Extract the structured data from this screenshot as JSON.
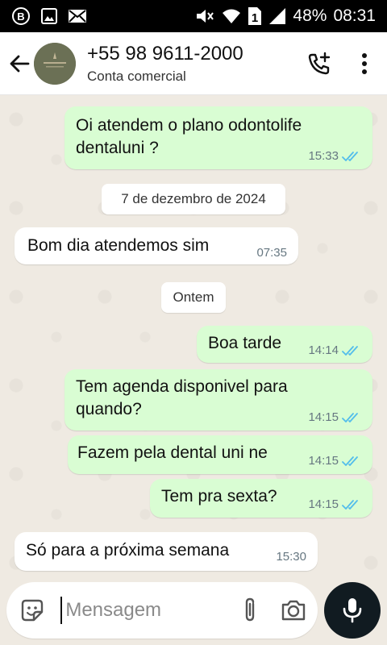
{
  "status_bar": {
    "battery": "48%",
    "time": "08:31",
    "sim_slot": "1",
    "icons": [
      "b-icon",
      "gallery-icon",
      "mail-icon",
      "mute-icon",
      "wifi-icon",
      "sim-icon",
      "signal-icon"
    ]
  },
  "header": {
    "contact_name": "+55 98 9611-2000",
    "subtitle": "Conta comercial",
    "icons": [
      "back-arrow-icon",
      "avatar",
      "add-call-icon",
      "more-vert-icon"
    ]
  },
  "messages": [
    {
      "direction": "out",
      "text_line1": "Oi atendem o plano odontolife",
      "text_line2": "dentaluni ?",
      "time": "15:33",
      "read": true
    },
    {
      "type": "date",
      "label": "7 de dezembro de 2024"
    },
    {
      "direction": "in",
      "text": "Bom dia atendemos sim",
      "time": "07:35"
    },
    {
      "type": "date",
      "label": "Ontem"
    },
    {
      "direction": "out",
      "text": "Boa tarde",
      "time": "14:14",
      "read": true
    },
    {
      "direction": "out",
      "text_line1": "Tem agenda disponivel para",
      "text_line2": "quando?",
      "time": "14:15",
      "read": true
    },
    {
      "direction": "out",
      "text": "Fazem pela dental uni ne",
      "time": "14:15",
      "read": true
    },
    {
      "direction": "out",
      "text": "Tem pra sexta?",
      "time": "14:15",
      "read": true
    },
    {
      "direction": "in",
      "text": "Só para a próxima semana",
      "time": "15:30"
    }
  ],
  "composer": {
    "placeholder": "Mensagem",
    "icons": [
      "sticker-icon",
      "attach-icon",
      "camera-icon",
      "mic-icon"
    ]
  },
  "colors": {
    "outgoing_bubble": "#d9fdd3",
    "incoming_bubble": "#ffffff",
    "read_tick": "#53bdeb",
    "chat_background": "#efeae2"
  }
}
